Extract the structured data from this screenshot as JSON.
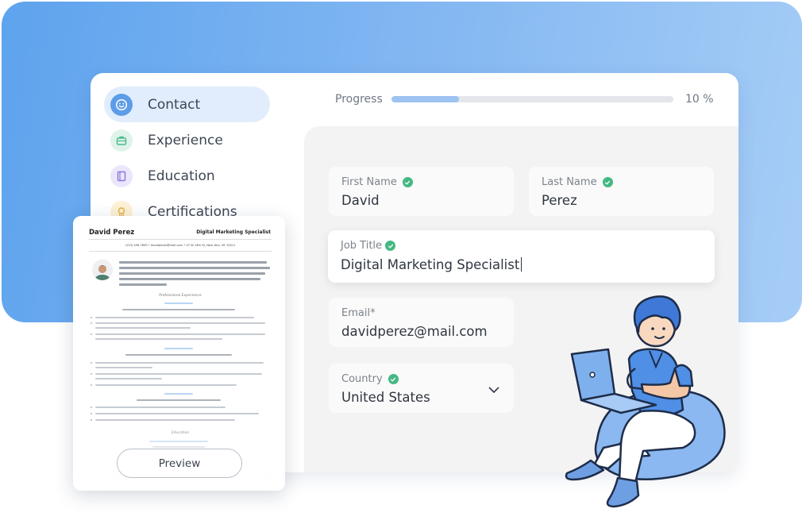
{
  "sidebar": {
    "items": [
      {
        "label": "Contact",
        "icon": "smiley-face-icon",
        "active": true
      },
      {
        "label": "Experience",
        "icon": "briefcase-icon"
      },
      {
        "label": "Education",
        "icon": "book-icon"
      },
      {
        "label": "Certifications",
        "icon": "ribbon-badge-icon"
      }
    ]
  },
  "progress": {
    "label": "Progress",
    "value_text": "10 %",
    "fraction": 0.24
  },
  "form": {
    "first_name": {
      "label": "First Name",
      "value": "David"
    },
    "last_name": {
      "label": "Last Name",
      "value": "Perez"
    },
    "job_title": {
      "label": "Job Title",
      "value": "Digital Marketing Specialist"
    },
    "email": {
      "label": "Email*",
      "value": "davidperez@mail.com"
    },
    "country": {
      "label": "Country",
      "value": "United States"
    }
  },
  "resume": {
    "name": "David Perez",
    "title": "Digital Marketing Specialist",
    "contact": "(123) 456-7890   •   davidperez@mail.com   •   47 W 13th St, New York, NY 10011",
    "section_experience": "Professional Experience",
    "section_education": "Education",
    "preview_label": "Preview"
  },
  "colors": {
    "accent": "#5ea3ee",
    "check": "#45b883",
    "progress_fill": "#9cc3f1",
    "nav_active_bg": "#e1edfc"
  }
}
